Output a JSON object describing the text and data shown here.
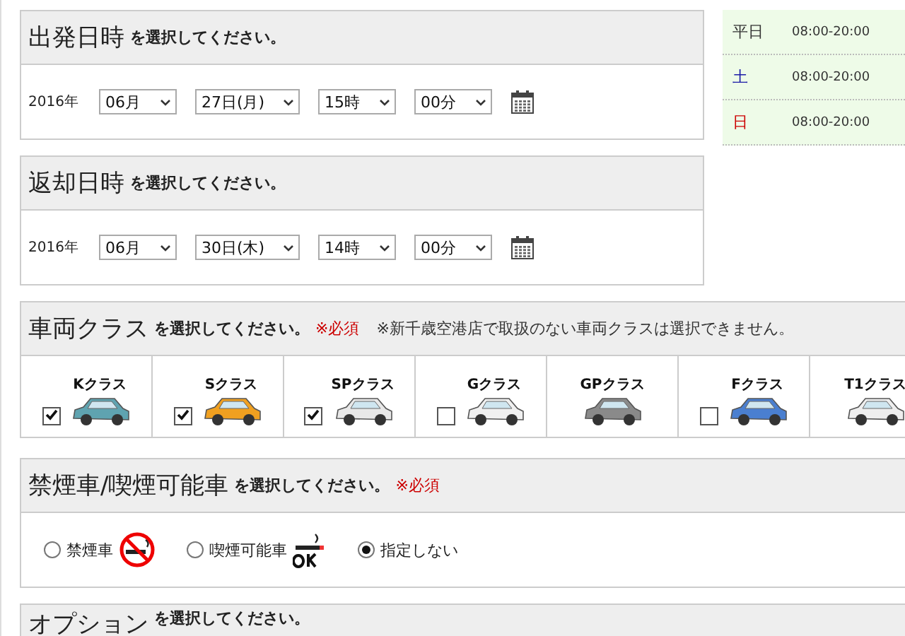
{
  "departure": {
    "title": "出発日時",
    "subtitle": "を選択してください。",
    "year": "2016年",
    "selects": [
      "06月",
      "27日(月)",
      "15時",
      "00分"
    ]
  },
  "return": {
    "title": "返却日時",
    "subtitle": "を選択してください。",
    "year": "2016年",
    "selects": [
      "06月",
      "30日(木)",
      "14時",
      "00分"
    ]
  },
  "hours": [
    {
      "day": "平日",
      "time": "08:00-20:00",
      "color": "#333333"
    },
    {
      "day": "土",
      "time": "08:00-20:00",
      "color": "#1a1aa6"
    },
    {
      "day": "日",
      "time": "08:00-20:00",
      "color": "#cc0000"
    }
  ],
  "vehicle": {
    "title": "車両クラス",
    "subtitle": "を選択してください。",
    "required": "※必須",
    "note": "※新千歳空港店で取扱のない車両クラスは選択できません。",
    "classes": [
      {
        "label": "Kクラス",
        "kind": "checkbox",
        "checked": true,
        "color": "#5fa3b0"
      },
      {
        "label": "Sクラス",
        "kind": "checkbox",
        "checked": true,
        "color": "#f0a020"
      },
      {
        "label": "SPクラス",
        "kind": "checkbox",
        "checked": true,
        "color": "#e8e8e8"
      },
      {
        "label": "Gクラス",
        "kind": "checkbox",
        "checked": false,
        "color": "#f0f0f0"
      },
      {
        "label": "GPクラス",
        "kind": "none",
        "color": "#8a8a8a"
      },
      {
        "label": "Fクラス",
        "kind": "checkbox",
        "checked": false,
        "color": "#4a7fd0"
      },
      {
        "label": "T1クラス",
        "kind": "none",
        "color": "#eeeeee"
      }
    ]
  },
  "smoking": {
    "title": "禁煙車/喫煙可能車",
    "subtitle": "を選択してください。",
    "required": "※必須",
    "options": [
      {
        "label": "禁煙車",
        "kind": "no-smoking",
        "selected": false
      },
      {
        "label": "喫煙可能車",
        "kind": "smoking-ok",
        "selected": false
      },
      {
        "label": "指定しない",
        "kind": "plain",
        "selected": true
      }
    ]
  },
  "options": {
    "title": "オプション",
    "subtitle": "を選択してください。"
  }
}
